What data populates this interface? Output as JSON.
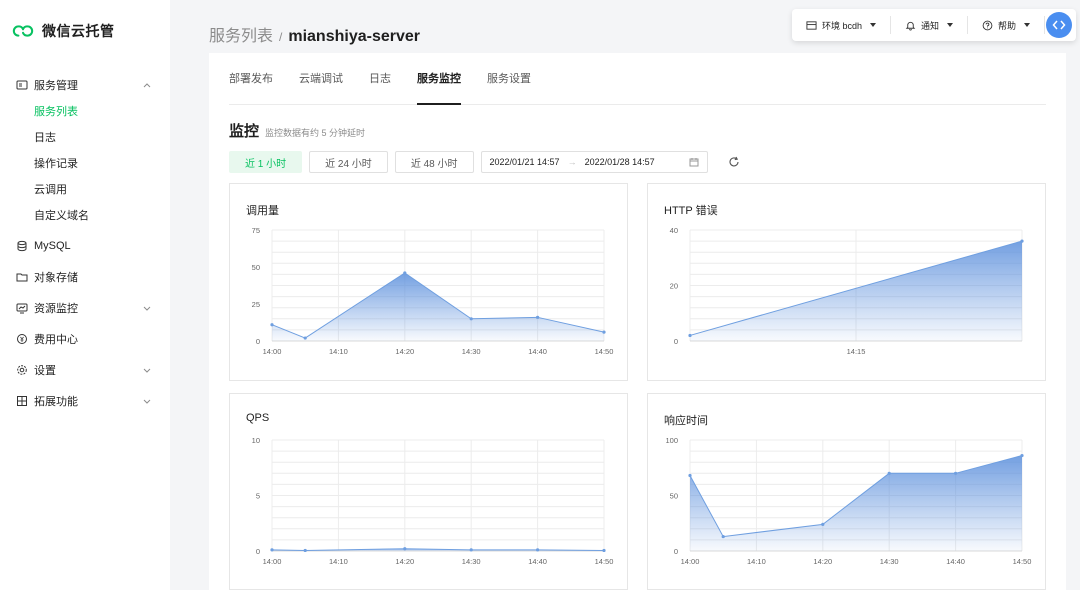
{
  "brand": {
    "name": "微信云托管"
  },
  "sidebar": {
    "groups": [
      {
        "label": "服务管理",
        "icon": "server-icon",
        "expanded": true,
        "children": [
          {
            "label": "服务列表",
            "active": true
          },
          {
            "label": "日志"
          },
          {
            "label": "操作记录"
          },
          {
            "label": "云调用"
          },
          {
            "label": "自定义域名"
          }
        ]
      },
      {
        "label": "MySQL",
        "icon": "database-icon"
      },
      {
        "label": "对象存储",
        "icon": "folder-icon"
      },
      {
        "label": "资源监控",
        "icon": "monitor-icon",
        "expandable": true
      },
      {
        "label": "费用中心",
        "icon": "coin-icon"
      },
      {
        "label": "设置",
        "icon": "gear-icon",
        "expandable": true
      },
      {
        "label": "拓展功能",
        "icon": "grid-icon",
        "expandable": true
      }
    ]
  },
  "topbar": {
    "env_label": "环境 bcdh",
    "notify_label": "通知",
    "help_label": "帮助"
  },
  "breadcrumb": {
    "parent": "服务列表",
    "separator": "/",
    "current": "mianshiya-server"
  },
  "tabs": [
    {
      "label": "部署发布"
    },
    {
      "label": "云端调试"
    },
    {
      "label": "日志"
    },
    {
      "label": "服务监控",
      "active": true
    },
    {
      "label": "服务设置"
    }
  ],
  "monitor": {
    "title": "监控",
    "hint": "监控数据有约 5 分钟延时",
    "ranges": [
      {
        "label": "近 1 小时",
        "active": true
      },
      {
        "label": "近 24 小时"
      },
      {
        "label": "近 48 小时"
      }
    ],
    "date_start": "2022/01/21 14:57",
    "date_arrow": "→",
    "date_end": "2022/01/28 14:57"
  },
  "colors": {
    "accent": "#07c160",
    "chart_line": "#6f9fe0",
    "chart_fill": "#5b8fdc"
  },
  "chart_data": [
    {
      "type": "area",
      "title": "调用量",
      "x": [
        "14:00",
        "14:05",
        "14:20",
        "14:30",
        "14:40",
        "14:50"
      ],
      "values": [
        11,
        2,
        46,
        15,
        16,
        6
      ],
      "xticks": [
        "14:00",
        "14:10",
        "14:20",
        "14:30",
        "14:40",
        "14:50"
      ],
      "yticks": [
        0,
        25,
        50,
        75
      ],
      "ylim": [
        0,
        75
      ],
      "grid": true
    },
    {
      "type": "area",
      "title": "HTTP 错误",
      "x": [
        "14:00",
        "14:30"
      ],
      "values": [
        2,
        36
      ],
      "xticks": [
        "14:15"
      ],
      "yticks": [
        0,
        20,
        40
      ],
      "ylim": [
        0,
        40
      ],
      "grid": true
    },
    {
      "type": "area",
      "title": "QPS",
      "x": [
        "14:00",
        "14:05",
        "14:20",
        "14:30",
        "14:40",
        "14:50"
      ],
      "values": [
        0.1,
        0.05,
        0.2,
        0.1,
        0.1,
        0.05
      ],
      "xticks": [
        "14:00",
        "14:10",
        "14:20",
        "14:30",
        "14:40",
        "14:50"
      ],
      "yticks": [
        0,
        5,
        10
      ],
      "ylim": [
        0,
        10
      ],
      "grid": true
    },
    {
      "type": "area",
      "title": "响应时间",
      "x": [
        "14:00",
        "14:05",
        "14:20",
        "14:30",
        "14:40",
        "14:50"
      ],
      "values": [
        68,
        13,
        24,
        70,
        70,
        86
      ],
      "xticks": [
        "14:00",
        "14:10",
        "14:20",
        "14:30",
        "14:40",
        "14:50"
      ],
      "yticks": [
        0,
        50,
        100
      ],
      "ylim": [
        0,
        100
      ],
      "grid": true
    }
  ]
}
